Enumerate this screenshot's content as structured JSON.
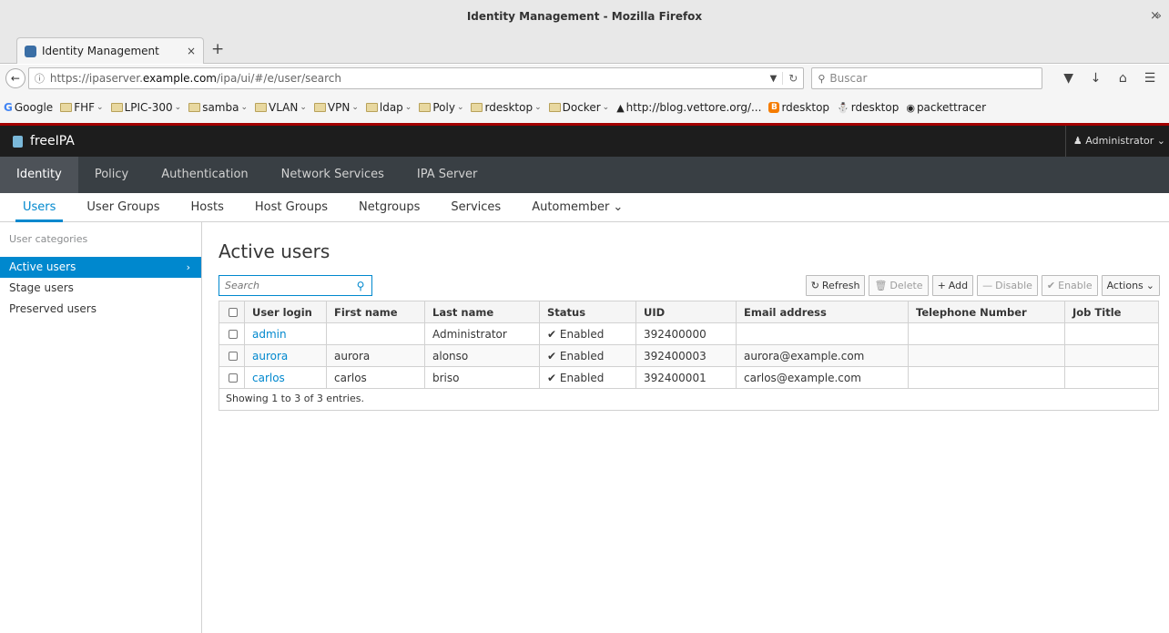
{
  "window": {
    "title": "Identity Management - Mozilla Firefox",
    "close": "×"
  },
  "browser": {
    "tab_label": "Identity Management",
    "tab_close": "×",
    "new_tab": "+",
    "url_prefix": "https://ipaserver.",
    "url_domain": "example.com",
    "url_path": "/ipa/ui/#/e/user/search",
    "search_placeholder": "Buscar",
    "bookmarks_more": "»",
    "bookmarks": [
      {
        "label": "Google",
        "icon": "google-icon"
      },
      {
        "label": "FHF",
        "icon": "folder-icon"
      },
      {
        "label": "LPIC-300",
        "icon": "folder-icon"
      },
      {
        "label": "samba",
        "icon": "folder-icon"
      },
      {
        "label": "VLAN",
        "icon": "folder-icon"
      },
      {
        "label": "VPN",
        "icon": "folder-icon"
      },
      {
        "label": "ldap",
        "icon": "folder-icon"
      },
      {
        "label": "Poly",
        "icon": "folder-icon"
      },
      {
        "label": "rdesktop",
        "icon": "folder-icon"
      },
      {
        "label": "Docker",
        "icon": "folder-icon"
      },
      {
        "label": "http://blog.vettore.org/...",
        "icon": "site-icon"
      },
      {
        "label": "rdesktop",
        "icon": "blogger-icon"
      },
      {
        "label": "rdesktop",
        "icon": "linux-icon"
      },
      {
        "label": "packettracer",
        "icon": "globe-icon"
      }
    ]
  },
  "app": {
    "brand": "freeIPA",
    "user": "Administrator",
    "primary_nav": [
      "Identity",
      "Policy",
      "Authentication",
      "Network Services",
      "IPA Server"
    ],
    "secondary_nav": [
      "Users",
      "User Groups",
      "Hosts",
      "Host Groups",
      "Netgroups",
      "Services",
      "Automember"
    ],
    "sidebar": {
      "header": "User categories",
      "items": [
        "Active users",
        "Stage users",
        "Preserved users"
      ]
    },
    "page_title": "Active users",
    "search_placeholder": "Search",
    "buttons": {
      "refresh": "Refresh",
      "delete": "Delete",
      "add": "Add",
      "disable": "Disable",
      "enable": "Enable",
      "actions": "Actions"
    },
    "table": {
      "columns": [
        "User login",
        "First name",
        "Last name",
        "Status",
        "UID",
        "Email address",
        "Telephone Number",
        "Job Title"
      ],
      "rows": [
        {
          "login": "admin",
          "first": "",
          "last": "Administrator",
          "status": "Enabled",
          "uid": "392400000",
          "email": "",
          "phone": "",
          "job": ""
        },
        {
          "login": "aurora",
          "first": "aurora",
          "last": "alonso",
          "status": "Enabled",
          "uid": "392400003",
          "email": "aurora@example.com",
          "phone": "",
          "job": ""
        },
        {
          "login": "carlos",
          "first": "carlos",
          "last": "briso",
          "status": "Enabled",
          "uid": "392400001",
          "email": "carlos@example.com",
          "phone": "",
          "job": ""
        }
      ],
      "footer": "Showing 1 to 3 of 3 entries."
    }
  }
}
